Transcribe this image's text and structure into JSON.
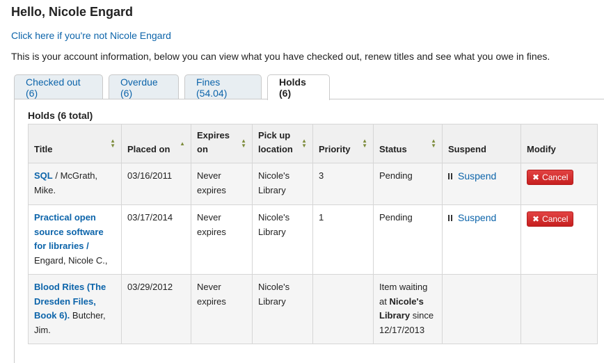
{
  "header": {
    "greeting": "Hello, Nicole Engard",
    "not_me_link": "Click here if you're not Nicole Engard",
    "intro": "This is your account information, below you can view what you have checked out, renew titles and see what you owe in fines."
  },
  "tabs": [
    {
      "label": "Checked out (6)"
    },
    {
      "label": "Overdue (6)"
    },
    {
      "label": "Fines (54.04)"
    },
    {
      "label": "Holds (6)"
    }
  ],
  "holds": {
    "title": "Holds (6 total)",
    "columns": {
      "title": "Title",
      "placed_on": "Placed on",
      "expires_on": "Expires on",
      "pickup": "Pick up location",
      "priority": "Priority",
      "status": "Status",
      "suspend": "Suspend",
      "modify": "Modify"
    },
    "rows": [
      {
        "title": "SQL",
        "sep": " / ",
        "author": "McGrath, Mike.",
        "placed_on": "03/16/2011",
        "expires": "Never expires",
        "pickup": "Nicole's Library",
        "priority": "3",
        "status": "Pending",
        "suspend_label": "Suspend",
        "cancel_label": "Cancel"
      },
      {
        "title": "Practical open source software for libraries /",
        "author": "Engard, Nicole C.,",
        "placed_on": "03/17/2014",
        "expires": "Never expires",
        "pickup": "Nicole's Library",
        "priority": "1",
        "status": "Pending",
        "suspend_label": "Suspend",
        "cancel_label": "Cancel"
      },
      {
        "title": "Blood Rites (The Dresden Files, Book 6).",
        "author": "Butcher, Jim.",
        "placed_on": "03/29/2012",
        "expires": "Never expires",
        "pickup": "Nicole's Library",
        "priority": "",
        "status_prefix": "Item waiting at",
        "status_location": "Nicole's Library",
        "status_suffix": "since 12/17/2013"
      }
    ]
  },
  "colors": {
    "link": "#0c64aa",
    "cancel_button": "#da2a2a",
    "tab_inactive": "#e8eef2",
    "header_bg": "#f0f0f0",
    "sort_arrow": "#7d8c3c"
  },
  "icons": {
    "suspend": "pause-icon",
    "cancel": "close-icon",
    "sort": "sort-arrows-icon"
  }
}
